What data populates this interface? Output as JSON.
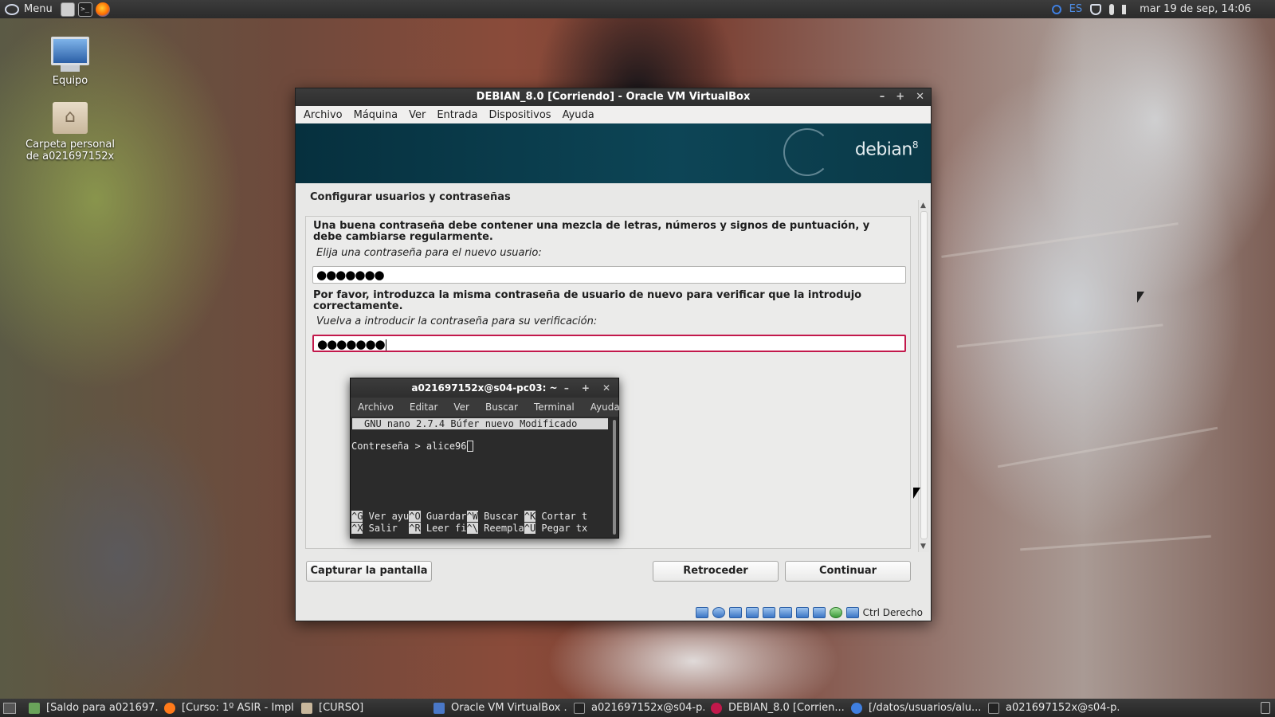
{
  "top_panel": {
    "menu_label": "Menu",
    "tray": {
      "language": "ES",
      "datetime": "mar 19 de sep, 14:06"
    }
  },
  "desktop": {
    "icons": [
      {
        "label": "Equipo"
      },
      {
        "label": "Carpeta personal de a021697152x"
      }
    ]
  },
  "vbox_window": {
    "title": "DEBIAN_8.0 [Corriendo] - Oracle VM VirtualBox",
    "menu": [
      "Archivo",
      "Máquina",
      "Ver",
      "Entrada",
      "Dispositivos",
      "Ayuda"
    ],
    "banner": {
      "word": "debian",
      "version": "8"
    },
    "installer": {
      "section_title": "Configurar usuarios y contraseñas",
      "description_1": "Una buena contraseña debe contener una mezcla de letras, números y signos de puntuación, y debe cambiarse regularmente.",
      "prompt_1": "Elija una contraseña para el nuevo usuario:",
      "password_1": "●●●●●●●",
      "description_2": "Por favor, introduzca la misma contraseña de usuario de nuevo para verificar que la introdujo correctamente.",
      "prompt_2": "Vuelva a introducir la contraseña para su verificación:",
      "password_2": "●●●●●●●",
      "buttons": {
        "screenshot": "Capturar la pantalla",
        "back": "Retroceder",
        "continue": "Continuar"
      }
    },
    "statusbar": {
      "host_key": "Ctrl Derecho"
    }
  },
  "terminal": {
    "title": "a021697152x@s04-pc03: ~",
    "menu": [
      "Archivo",
      "Editar",
      "Ver",
      "Buscar",
      "Terminal",
      "Ayuda"
    ],
    "nano_header": "GNU nano 2.7.4 Búfer nuevo Modificado",
    "content_line": "Contreseña > alice96",
    "shortcuts_row1": [
      {
        "key": "^G",
        "label": " Ver ayu"
      },
      {
        "key": "^O",
        "label": " Guardar"
      },
      {
        "key": "^W",
        "label": " Buscar "
      },
      {
        "key": "^K",
        "label": " Cortar t"
      }
    ],
    "shortcuts_row2": [
      {
        "key": "^X",
        "label": " Salir  "
      },
      {
        "key": "^R",
        "label": " Leer fi"
      },
      {
        "key": "^\\",
        "label": " Reempla"
      },
      {
        "key": "^U",
        "label": " Pegar tx"
      }
    ]
  },
  "taskbar": {
    "tasks": [
      "[Saldo para a021697...",
      "[Curso: 1º ASIR - Impl...",
      "[CURSO]",
      "Oracle VM VirtualBox ...",
      "a021697152x@s04-p...",
      "DEBIAN_8.0 [Corrien...",
      "[/datos/usuarios/alu...",
      "a021697152x@s04-p..."
    ]
  }
}
